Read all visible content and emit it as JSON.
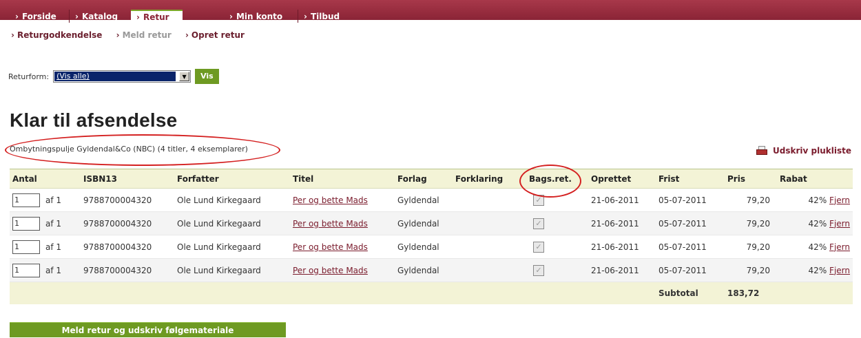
{
  "nav": {
    "tabs": [
      {
        "label": "Forside"
      },
      {
        "label": "Katalog"
      },
      {
        "label": "Retur"
      },
      {
        "label": "Min konto"
      },
      {
        "label": "Tilbud"
      }
    ],
    "subnav": [
      {
        "label": "Returgodkendelse"
      },
      {
        "label": "Meld retur"
      },
      {
        "label": "Opret retur"
      }
    ]
  },
  "filter": {
    "label": "Returform:",
    "selected": "(Vis alle)",
    "button": "Vis"
  },
  "heading": "Klar til afsendelse",
  "pool": "Ombytningspulje Gyldendal&Co (NBC) (4 titler, 4 eksemplarer)",
  "print_label": "Udskriv plukliste",
  "table": {
    "headers": [
      "Antal",
      "ISBN13",
      "Forfatter",
      "Titel",
      "Forlag",
      "Forklaring",
      "Bags.ret.",
      "Oprettet",
      "Frist",
      "Pris",
      "Rabat"
    ],
    "rows": [
      {
        "qty": "1",
        "af": "af 1",
        "isbn": "9788700004320",
        "author": "Ole Lund Kirkegaard",
        "title": "Per og bette Mads",
        "publisher": "Gyldendal",
        "created": "21-06-2011",
        "deadline": "05-07-2011",
        "price": "79,20",
        "discount": "42%",
        "remove": "Fjern"
      },
      {
        "qty": "1",
        "af": "af 1",
        "isbn": "9788700004320",
        "author": "Ole Lund Kirkegaard",
        "title": "Per og bette Mads",
        "publisher": "Gyldendal",
        "created": "21-06-2011",
        "deadline": "05-07-2011",
        "price": "79,20",
        "discount": "42%",
        "remove": "Fjern"
      },
      {
        "qty": "1",
        "af": "af 1",
        "isbn": "9788700004320",
        "author": "Ole Lund Kirkegaard",
        "title": "Per og bette Mads",
        "publisher": "Gyldendal",
        "created": "21-06-2011",
        "deadline": "05-07-2011",
        "price": "79,20",
        "discount": "42%",
        "remove": "Fjern"
      },
      {
        "qty": "1",
        "af": "af 1",
        "isbn": "9788700004320",
        "author": "Ole Lund Kirkegaard",
        "title": "Per og bette Mads",
        "publisher": "Gyldendal",
        "created": "21-06-2011",
        "deadline": "05-07-2011",
        "price": "79,20",
        "discount": "42%",
        "remove": "Fjern"
      }
    ],
    "subtotal_label": "Subtotal",
    "subtotal_value": "183,72"
  },
  "submit_label": "Meld retur og udskriv følgemateriale",
  "colors": {
    "brand": "#8a2436",
    "accent": "#6e9a22",
    "annotation": "#d42020"
  }
}
